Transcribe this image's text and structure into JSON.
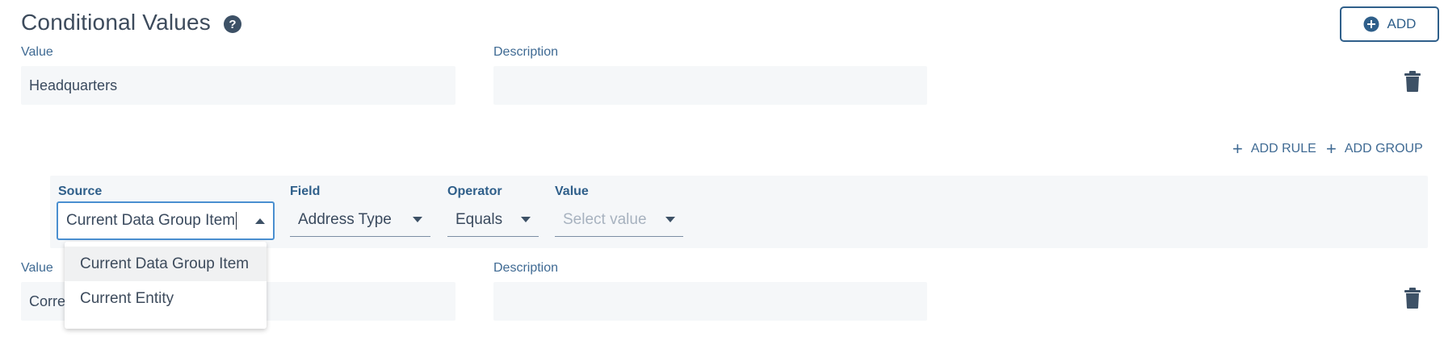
{
  "header": {
    "title": "Conditional Values",
    "add_label": "ADD"
  },
  "row1": {
    "value_label": "Value",
    "value": "Headquarters",
    "description_label": "Description",
    "description": ""
  },
  "actions": {
    "add_rule": "ADD RULE",
    "add_group": "ADD GROUP"
  },
  "rule": {
    "source_label": "Source",
    "source_value": "Current Data Group Item",
    "field_label": "Field",
    "field_value": "Address Type",
    "operator_label": "Operator",
    "operator_value": "Equals",
    "value_label": "Value",
    "value_placeholder": "Select value"
  },
  "source_options": [
    "Current Data Group Item",
    "Current Entity"
  ],
  "row2": {
    "value_label": "Value",
    "value": "Corre",
    "description_label": "Description",
    "description": ""
  },
  "colors": {
    "accent": "#2f5f8a",
    "focus": "#4a8fd0",
    "input_bg": "#f5f7f9"
  }
}
